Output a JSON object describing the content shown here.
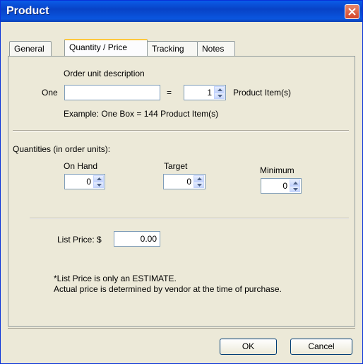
{
  "window": {
    "title": "Product"
  },
  "tabs": [
    {
      "label": "General"
    },
    {
      "label": "Quantity / Price"
    },
    {
      "label": "Tracking"
    },
    {
      "label": "Notes"
    }
  ],
  "order_unit": {
    "heading": "Order unit description",
    "prefix": "One",
    "description_value": "",
    "equals": "=",
    "quantity_value": "1",
    "suffix": "Product Item(s)",
    "example": "Example: One Box = 144 Product Item(s)"
  },
  "quantities": {
    "heading": "Quantities (in order units):",
    "on_hand": {
      "label": "On Hand",
      "value": "0"
    },
    "target": {
      "label": "Target",
      "value": "0"
    },
    "minimum": {
      "label": "Minimum",
      "value": "0"
    }
  },
  "price": {
    "label": "List Price: $",
    "value": "0.00",
    "note_line1": "*List Price is only an ESTIMATE.",
    "note_line2": "Actual price is determined by vendor at the time of purchase."
  },
  "buttons": {
    "ok": "OK",
    "cancel": "Cancel"
  }
}
